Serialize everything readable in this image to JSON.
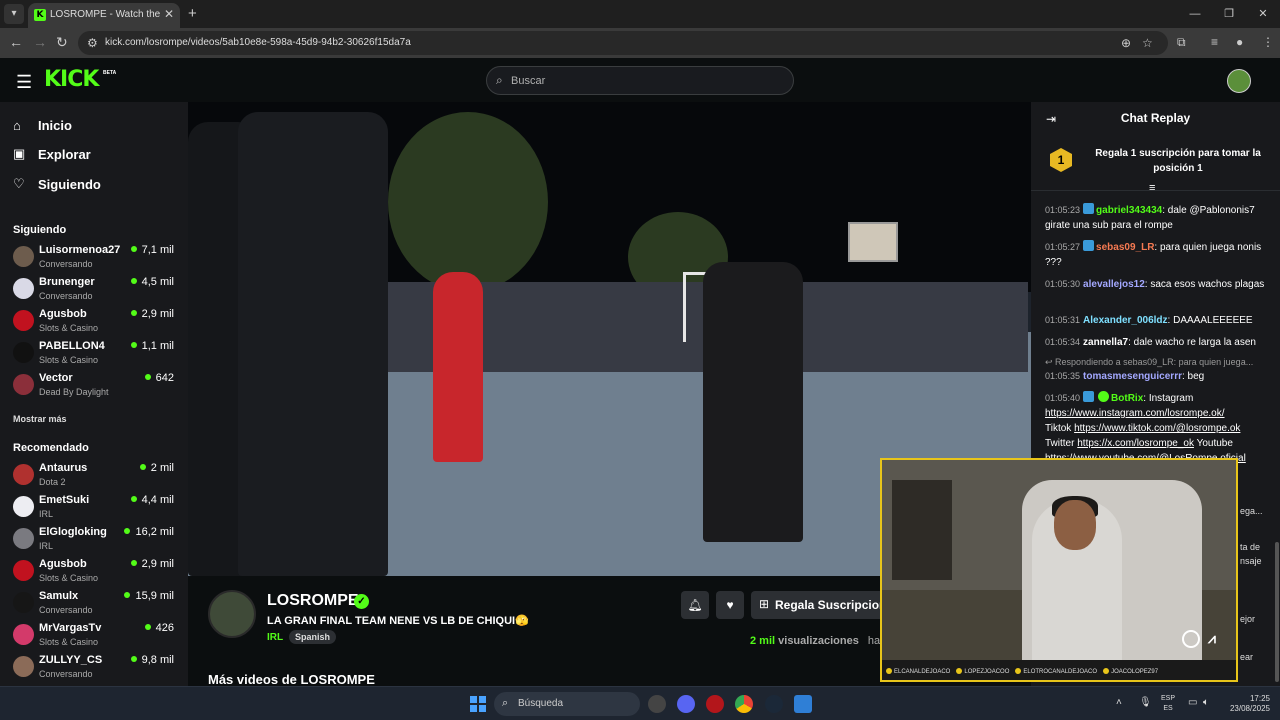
{
  "browser": {
    "tab_title": "LOSROMPE - Watch the VOD",
    "url": "kick.com/losrompe/videos/5ab10e8e-598a-45d9-94b2-30626f15da7a"
  },
  "header": {
    "logo": "KICK",
    "logo_badge": "BETA",
    "search_placeholder": "Buscar"
  },
  "sidebar": {
    "nav": [
      {
        "label": "Inicio",
        "icon": "home-icon"
      },
      {
        "label": "Explorar",
        "icon": "compass-icon"
      },
      {
        "label": "Siguiendo",
        "icon": "heart-icon"
      }
    ],
    "following_title": "Siguiendo",
    "following": [
      {
        "name": "Luisormenoa27",
        "category": "Conversando",
        "viewers": "7,1 mil",
        "color": "#6d5c4d"
      },
      {
        "name": "Brunenger",
        "category": "Conversando",
        "viewers": "4,5 mil",
        "color": "#d9d9e6"
      },
      {
        "name": "Agusbob",
        "category": "Slots & Casino",
        "viewers": "2,9 mil",
        "color": "#c1121f"
      },
      {
        "name": "PABELLON4",
        "category": "Slots & Casino",
        "viewers": "1,1 mil",
        "color": "#111111"
      },
      {
        "name": "Vector",
        "category": "Dead By Daylight",
        "viewers": "642",
        "color": "#8b2f3a"
      }
    ],
    "show_more": "Mostrar más",
    "recommended_title": "Recomendado",
    "recommended": [
      {
        "name": "Antaurus",
        "category": "Dota 2",
        "viewers": "2 mil",
        "color": "#b0312f"
      },
      {
        "name": "EmetSuki",
        "category": "IRL",
        "viewers": "4,4 mil",
        "color": "#ededf2"
      },
      {
        "name": "ElGlogloking",
        "category": "IRL",
        "viewers": "16,2 mil",
        "color": "#7a7a80"
      },
      {
        "name": "Agusbob",
        "category": "Slots & Casino",
        "viewers": "2,9 mil",
        "color": "#c1121f"
      },
      {
        "name": "Samulx",
        "category": "Conversando",
        "viewers": "15,9 mil",
        "color": "#161616"
      },
      {
        "name": "MrVargasTv",
        "category": "Slots & Casino",
        "viewers": "426",
        "color": "#d33a6a"
      },
      {
        "name": "ZULLYY_CS",
        "category": "Conversando",
        "viewers": "9,8 mil",
        "color": "#8b6b58"
      }
    ]
  },
  "video_info": {
    "streamer": "LOSROMPE",
    "title": "LA GRAN FINAL TEAM NENE VS LB DE CHIQUI🫣",
    "category": "IRL",
    "tag": "Spanish",
    "gift_label": "Regala Suscripciones",
    "views_num": "2 mil",
    "views_label": "visualizaciones",
    "views_tail": "ha",
    "more_videos": "Más videos de LOSROMPE"
  },
  "chat": {
    "title": "Chat Replay",
    "banner_rank": "1",
    "banner_text": "Regala 1 suscripción para tomar la posición 1",
    "messages": [
      {
        "time": "01:05:23",
        "user": "gabriel343434",
        "color": "#53fc18",
        "badge": "blue",
        "text": "dale @Pablononis7 girate una sub para el rompe"
      },
      {
        "time": "01:05:27",
        "user": "sebas09_LR",
        "color": "#f77a52",
        "badge": "blue",
        "text": "para quien juega nonis ???"
      },
      {
        "time": "01:05:30",
        "user": "alevallejos12",
        "color": "#a3a8ff",
        "badge": "",
        "text": "saca esos wachos plagas"
      },
      {
        "time": "01:05:31",
        "user": "Alexander_006ldz",
        "color": "#7fe0ff",
        "badge": "",
        "text": "DAAAALEEEEEE"
      },
      {
        "time": "01:05:34",
        "user": "zannella7",
        "color": "#ffffff",
        "badge": "",
        "text": "dale wacho re larga la asen"
      },
      {
        "time": "01:05:35",
        "user": "tomasmesenguicerrr",
        "color": "#a3a8ff",
        "badge": "",
        "text": "beg"
      },
      {
        "time": "01:05:40",
        "user": "BotRix",
        "color": "#53fc18",
        "badge": "both",
        "text": "Instagram"
      }
    ],
    "reply_ref": "Respondiendo a sebas09_LR: para quien juega...",
    "botrix_links": {
      "instagram": "https://www.instagram.com/losrompe.ok/",
      "tiktok_label": "Tiktok",
      "tiktok": "https://www.tiktok.com/@losrompe.ok",
      "twitter_label": "Twitter",
      "twitter": "https://x.com/losrompe_ok",
      "youtube_label": "Youtube",
      "youtube": "https://www.youtube.com/@LosRompe.oficial"
    },
    "behind_1": "ega...",
    "behind_2": "ta de",
    "behind_3": "nsaje",
    "behind_4": "ejor",
    "behind_5": "ear"
  },
  "webcam": {
    "handles": [
      "ELCANALDEJOACO",
      "LOPEZJOACOO",
      "ELOTROCANALDEJOACO",
      "JOACOLOPEZ97"
    ]
  },
  "taskbar": {
    "search_label": "Búsqueda",
    "lang_top": "ESP",
    "lang_bottom": "ES",
    "time": "17:25",
    "date": "23/08/2025"
  }
}
